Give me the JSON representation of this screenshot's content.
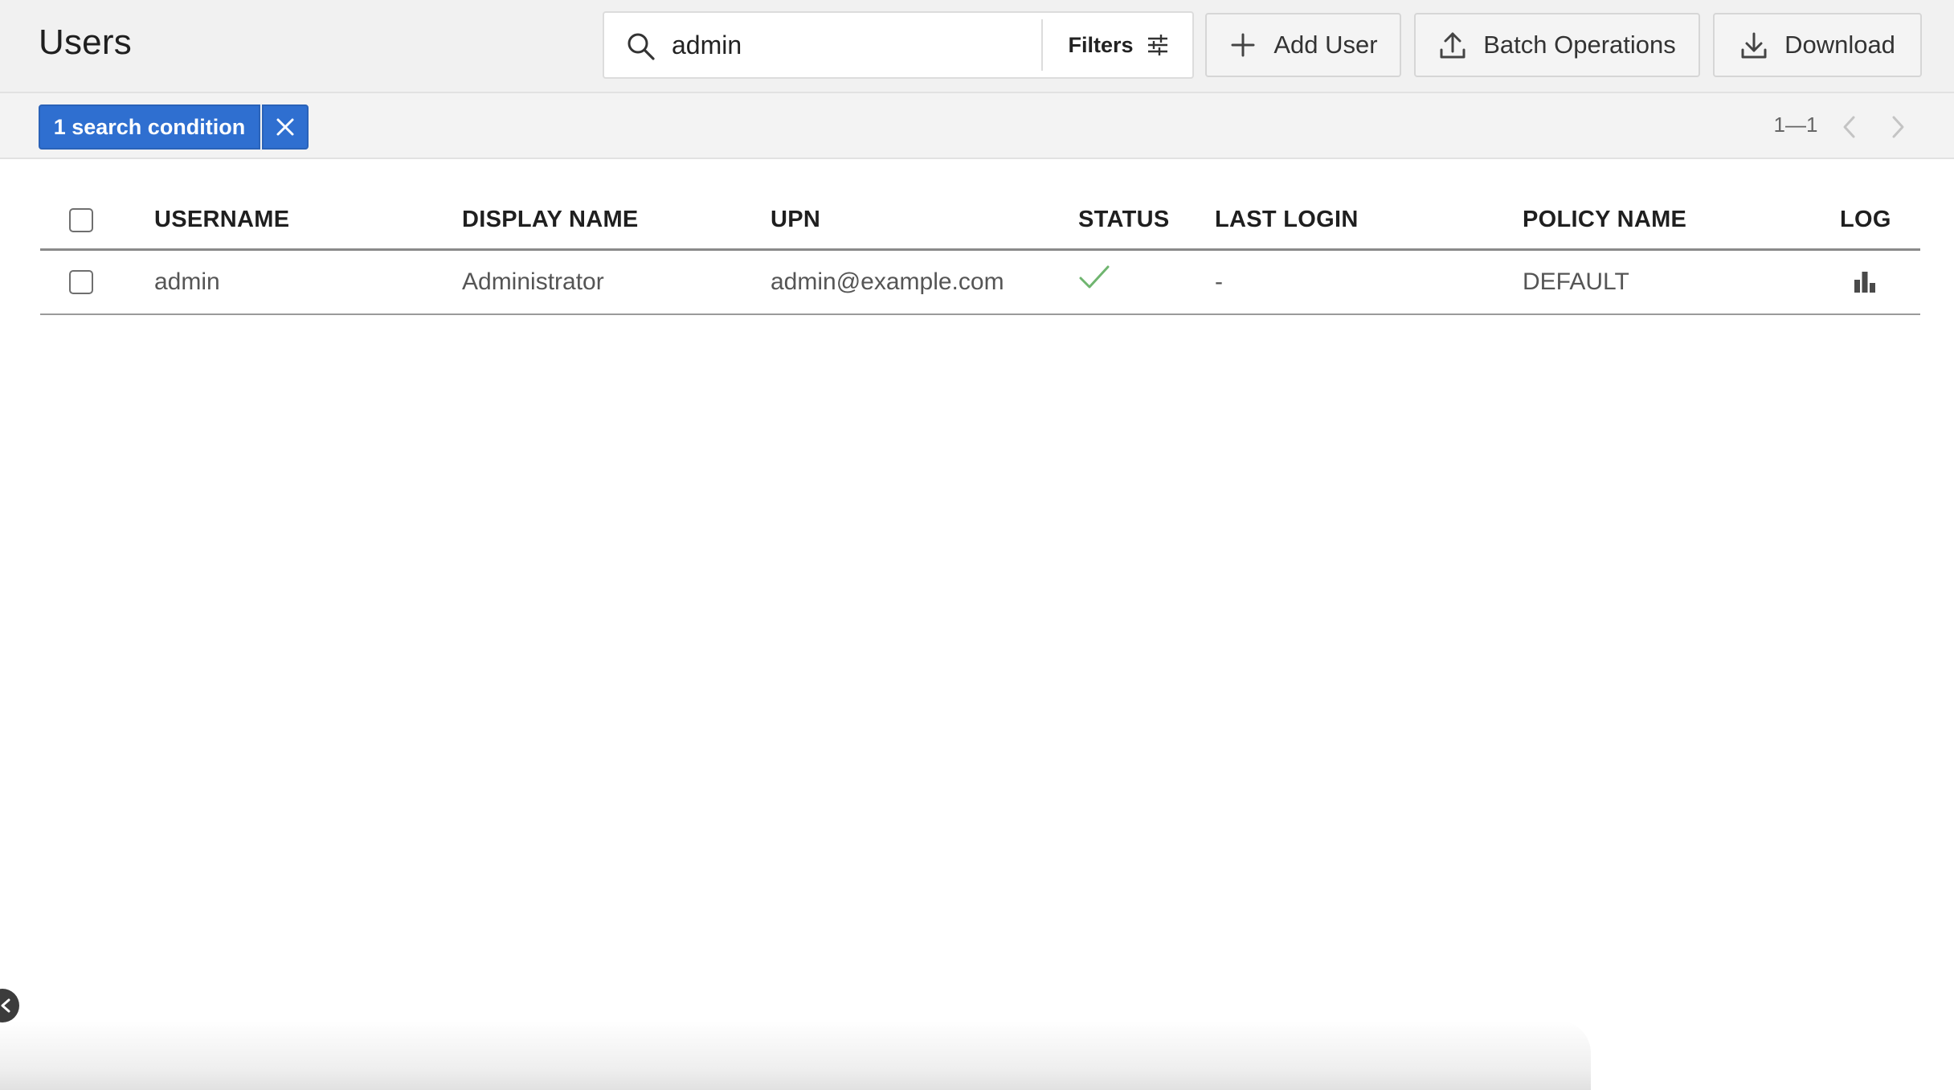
{
  "header": {
    "title": "Users",
    "search": {
      "value": "admin",
      "placeholder": "Search"
    },
    "filters_label": "Filters",
    "add_user_label": "Add User",
    "batch_operations_label": "Batch Operations",
    "download_label": "Download"
  },
  "subheader": {
    "search_chip_label": "1 search condition",
    "pagination_range": "1—1"
  },
  "table": {
    "columns": [
      "USERNAME",
      "DISPLAY NAME",
      "UPN",
      "STATUS",
      "LAST LOGIN",
      "POLICY NAME",
      "LOG"
    ],
    "rows": [
      {
        "username": "admin",
        "display_name": "Administrator",
        "upn": "admin@example.com",
        "status": "active",
        "last_login": "-",
        "policy_name": "DEFAULT",
        "log_icon": "bar-chart-icon"
      }
    ]
  },
  "colors": {
    "primary": "#2f6fd0",
    "status_ok": "#6fb56f",
    "header_bg": "#f1f1f1"
  }
}
